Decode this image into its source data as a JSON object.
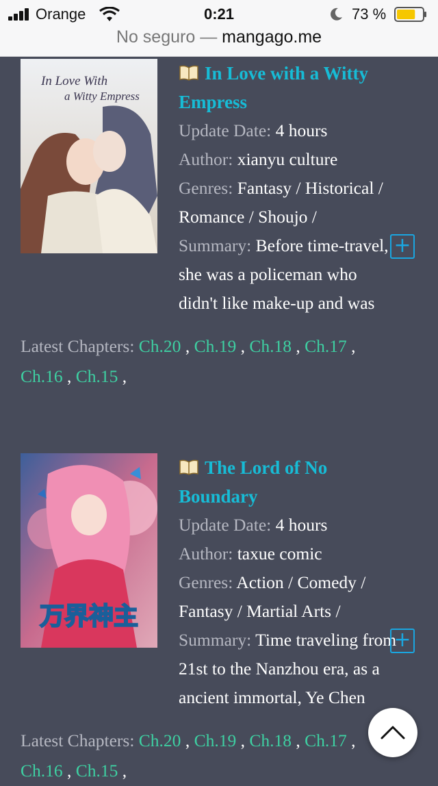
{
  "status": {
    "carrier": "Orange",
    "time": "0:21",
    "battery": "73 %",
    "battery_level": 0.73
  },
  "url_bar": {
    "prefix": "No seguro —",
    "domain": "mangago.me"
  },
  "entries": [
    {
      "cover_text_line1": "In Love With",
      "cover_text_line2": "a Witty Empress",
      "title_line1": "In Love with a Witty",
      "title_line2": "Empress",
      "update_label": "Update Date:",
      "update_value": "4 hours",
      "author_label": "Author:",
      "author_value": "xianyu culture",
      "genres_label": "Genres:",
      "genres_line1": "Fantasy / Historical /",
      "genres_line2": "Romance / Shoujo /",
      "summary_label": "Summary:",
      "summary_line1": "Before time-travel,",
      "summary_line2": "she was a policeman who",
      "summary_line3": "didn't like make-up and was",
      "latest_label": "Latest Chapters:",
      "chapters": [
        "Ch.20",
        "Ch.19",
        "Ch.18",
        "Ch.17",
        "Ch.16",
        "Ch.15"
      ]
    },
    {
      "cover_text_line1": "万界神主",
      "title_line1": "The Lord of No",
      "title_line2": "Boundary",
      "update_label": "Update Date:",
      "update_value": "4 hours",
      "author_label": "Author:",
      "author_value": "taxue comic",
      "genres_label": "Genres:",
      "genres_line1": "Action / Comedy /",
      "genres_line2": "Fantasy / Martial Arts /",
      "summary_label": "Summary:",
      "summary_line1": "Time traveling from",
      "summary_line2": "21st to the Nanzhou era, as a",
      "summary_line3": "ancient immortal, Ye Chen",
      "latest_label": "Latest Chapters:",
      "chapters": [
        "Ch.20",
        "Ch.19",
        "Ch.18",
        "Ch.17",
        "Ch.16",
        "Ch.15"
      ]
    }
  ],
  "colors": {
    "background": "#474b5a",
    "title": "#17bcd6",
    "chapter_link": "#3ed0a2",
    "label": "#b6b8c2",
    "add_button": "#1aa6e0"
  },
  "icons": [
    "book-icon",
    "plus-icon",
    "chevron-up-icon",
    "wifi-icon",
    "moon-icon",
    "battery-icon",
    "signal-icon"
  ]
}
